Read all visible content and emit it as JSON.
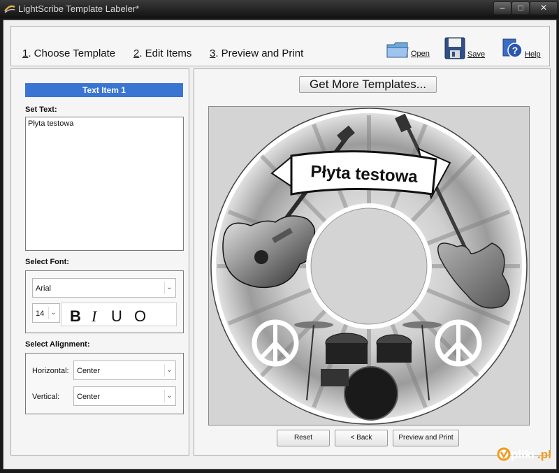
{
  "window": {
    "title": "LightScribe Template Labeler*",
    "buttons": {
      "minimize": "–",
      "maximize": "□",
      "close": "✕"
    }
  },
  "toolbar": {
    "steps": [
      {
        "number": "1",
        "label": ". Choose Template"
      },
      {
        "number": "2",
        "label": ". Edit Items"
      },
      {
        "number": "3",
        "label": ". Preview and Print"
      }
    ],
    "open_label": "Open",
    "save_label": "Save",
    "help_label": "Help"
  },
  "left_panel": {
    "item_header": "Text Item 1",
    "set_text_label": "Set Text:",
    "text_value": "Płyta testowa",
    "select_font_label": "Select Font:",
    "font_name": "Arial",
    "font_size": "14",
    "style_buttons": {
      "bold": "B",
      "italic": "I",
      "underline": "U",
      "outline": "O"
    },
    "select_alignment_label": "Select Alignment:",
    "horizontal_label": "Horizontal:",
    "horizontal_value": "Center",
    "vertical_label": "Vertical:",
    "vertical_value": "Center"
  },
  "right_panel": {
    "get_more_label": "Get More Templates...",
    "disc_label_text": "Płyta testowa",
    "reset_label": "Reset",
    "back_label": "< Back",
    "preview_print_label": "Preview and Print"
  },
  "watermark": {
    "text_main": "pliki",
    "text_suffix": ".pl"
  },
  "colors": {
    "accent": "#3a75d3",
    "titlebar": "#1e1e1e",
    "watermark_orange": "#f29a1d"
  }
}
